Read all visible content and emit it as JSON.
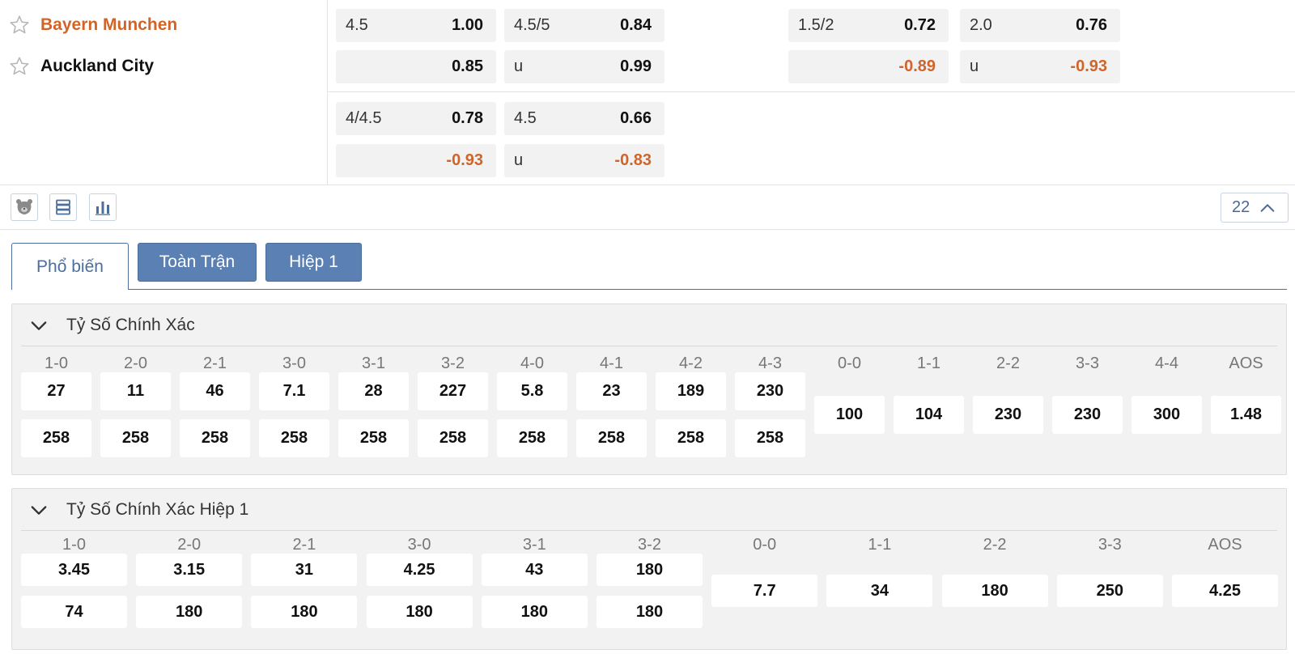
{
  "teams": {
    "home": "Bayern Munchen",
    "away": "Auckland City"
  },
  "odds_rows": [
    {
      "cells": [
        {
          "label": "4.5",
          "value": "1.00",
          "neg": false
        },
        {
          "label": "4.5/5",
          "value": "0.84",
          "neg": false
        },
        {
          "label": "1.5/2",
          "value": "0.72",
          "neg": false
        },
        {
          "label": "2.0",
          "value": "0.76",
          "neg": false
        },
        {
          "label": "",
          "value": "0.85",
          "neg": false
        },
        {
          "label": "u",
          "value": "0.99",
          "neg": false
        },
        {
          "label": "",
          "value": "-0.89",
          "neg": true
        },
        {
          "label": "u",
          "value": "-0.93",
          "neg": true
        }
      ]
    },
    {
      "cells": [
        {
          "label": "4/4.5",
          "value": "0.78",
          "neg": false
        },
        {
          "label": "4.5",
          "value": "0.66",
          "neg": false
        },
        {
          "label": "",
          "value": "-0.93",
          "neg": true
        },
        {
          "label": "u",
          "value": "-0.83",
          "neg": true
        }
      ]
    }
  ],
  "toolbar": {
    "count": "22",
    "icons": [
      "bear-icon",
      "list-icon",
      "bar-chart-icon",
      "chevron-up-icon"
    ]
  },
  "tabs": [
    {
      "label": "Phổ biến",
      "active": true
    },
    {
      "label": "Toàn Trận",
      "active": false
    },
    {
      "label": "Hiệp 1",
      "active": false
    }
  ],
  "sections": [
    {
      "title": "Tỷ Số Chính Xác",
      "paired": [
        {
          "score": "1-0",
          "home": "27",
          "away": "258"
        },
        {
          "score": "2-0",
          "home": "11",
          "away": "258"
        },
        {
          "score": "2-1",
          "home": "46",
          "away": "258"
        },
        {
          "score": "3-0",
          "home": "7.1",
          "away": "258"
        },
        {
          "score": "3-1",
          "home": "28",
          "away": "258"
        },
        {
          "score": "3-2",
          "home": "227",
          "away": "258"
        },
        {
          "score": "4-0",
          "home": "5.8",
          "away": "258"
        },
        {
          "score": "4-1",
          "home": "23",
          "away": "258"
        },
        {
          "score": "4-2",
          "home": "189",
          "away": "258"
        },
        {
          "score": "4-3",
          "home": "230",
          "away": "258"
        }
      ],
      "single": [
        {
          "score": "0-0",
          "value": "100"
        },
        {
          "score": "1-1",
          "value": "104"
        },
        {
          "score": "2-2",
          "value": "230"
        },
        {
          "score": "3-3",
          "value": "230"
        },
        {
          "score": "4-4",
          "value": "300"
        },
        {
          "score": "AOS",
          "value": "1.48"
        }
      ]
    },
    {
      "title": "Tỷ Số Chính Xác Hiệp 1",
      "paired": [
        {
          "score": "1-0",
          "home": "3.45",
          "away": "74"
        },
        {
          "score": "2-0",
          "home": "3.15",
          "away": "180"
        },
        {
          "score": "2-1",
          "home": "31",
          "away": "180"
        },
        {
          "score": "3-0",
          "home": "4.25",
          "away": "180"
        },
        {
          "score": "3-1",
          "home": "43",
          "away": "180"
        },
        {
          "score": "3-2",
          "home": "180",
          "away": "180"
        }
      ],
      "single": [
        {
          "score": "0-0",
          "value": "7.7"
        },
        {
          "score": "1-1",
          "value": "34"
        },
        {
          "score": "2-2",
          "value": "180"
        },
        {
          "score": "3-3",
          "value": "250"
        },
        {
          "score": "AOS",
          "value": "4.25"
        }
      ]
    }
  ]
}
